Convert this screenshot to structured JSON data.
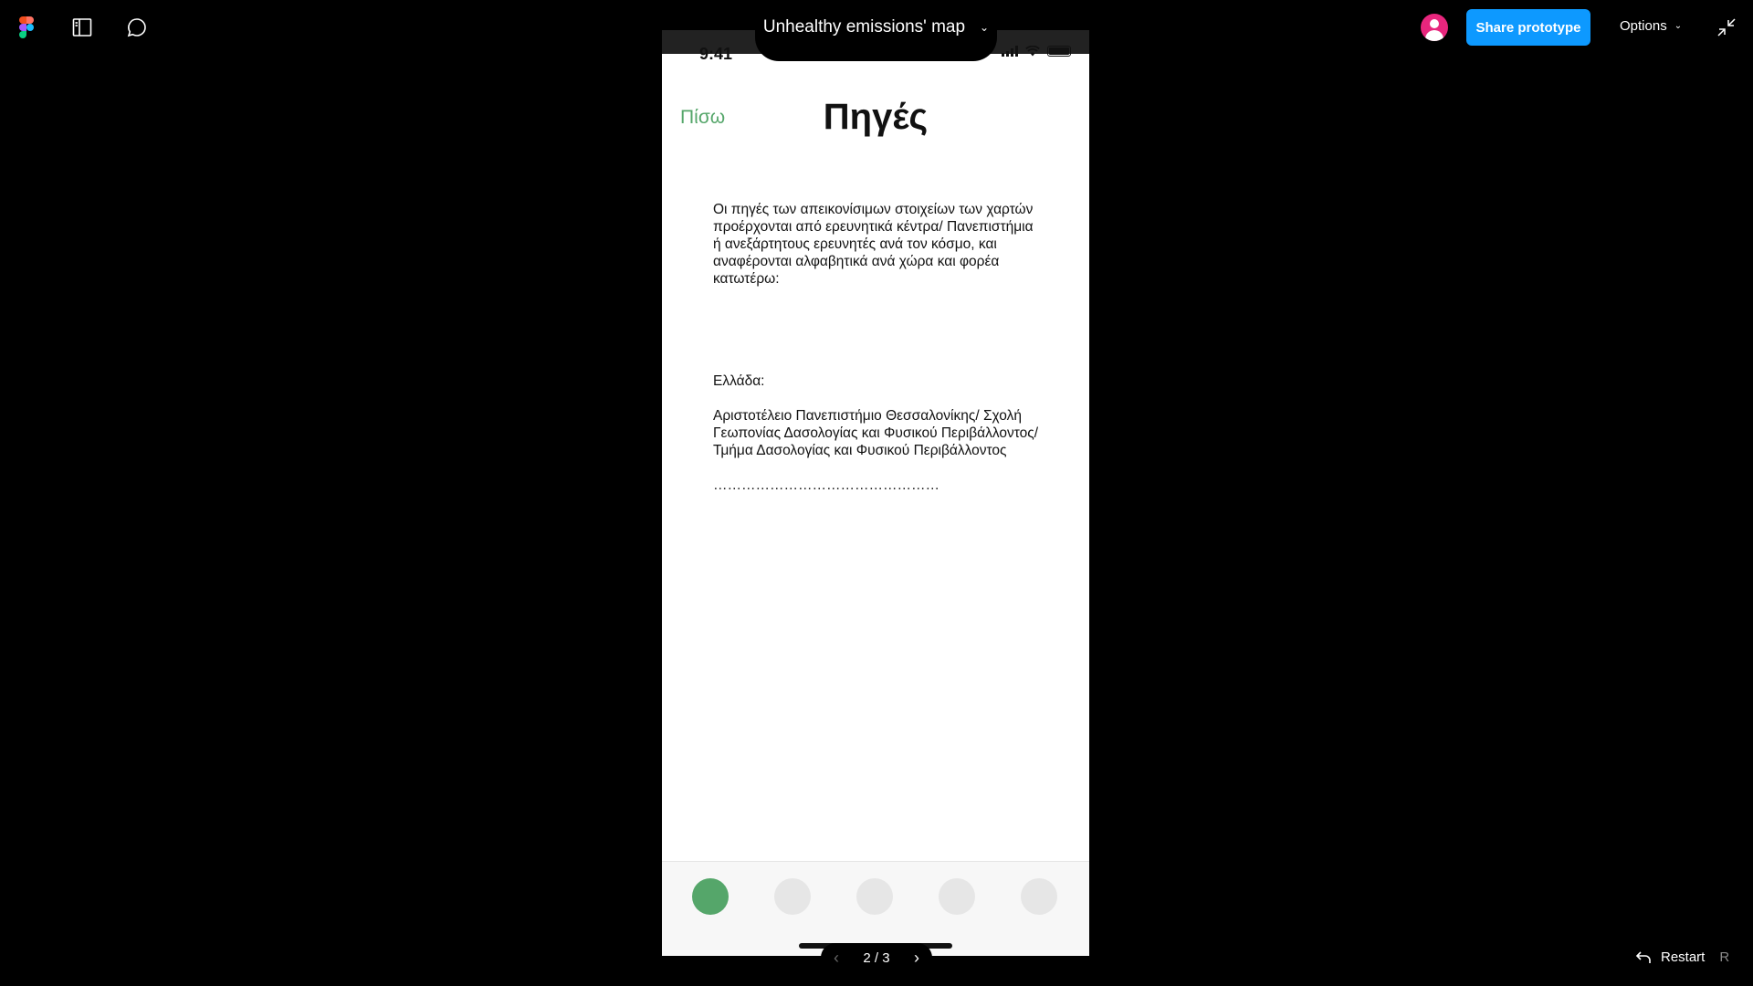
{
  "toolbar": {
    "figma_icon": "figma-logo-icon",
    "sidebar_icon": "sidebar-panel-icon",
    "comment_icon": "comment-icon",
    "title": "Unhealthy emissions' map",
    "title_chevron": "⌄",
    "share_label": "Share prototype",
    "options_label": "Options",
    "options_chevron": "⌄",
    "collapse_icon": "collapse-icon"
  },
  "phone": {
    "status_time": "9:41",
    "back_label": "Πίσω",
    "title": "Πηγές",
    "intro_text": "Οι πηγές των απεικονίσιμων στοιχείων των χαρτών προέρχονται από ερευνητικά κέντρα/ Πανεπιστήμια ή ανεξάρτητους ερευνητές ανά τον κόσμο, και αναφέρονται αλφαβητικά ανά χώρα και φορέα κατωτέρω:",
    "country": "Ελλάδα:",
    "institution": "Αριστοτέλειο Πανεπιστήμιο Θεσσαλονίκης/ Σχολή Γεωπονίας Δασολογίας και Φυσικού Περιβάλλοντος/Τμήμα Δασολογίας και Φυσικού Περιβάλλοντος",
    "dots": "…………………………………………",
    "tabs": [
      "tab-1",
      "tab-2",
      "tab-3",
      "tab-4",
      "tab-5"
    ],
    "active_tab": 0,
    "accent_color": "#55a66a"
  },
  "pager": {
    "prev": "‹",
    "count": "2 / 3",
    "next": "›"
  },
  "restart": {
    "label": "Restart",
    "shortcut": "R"
  }
}
